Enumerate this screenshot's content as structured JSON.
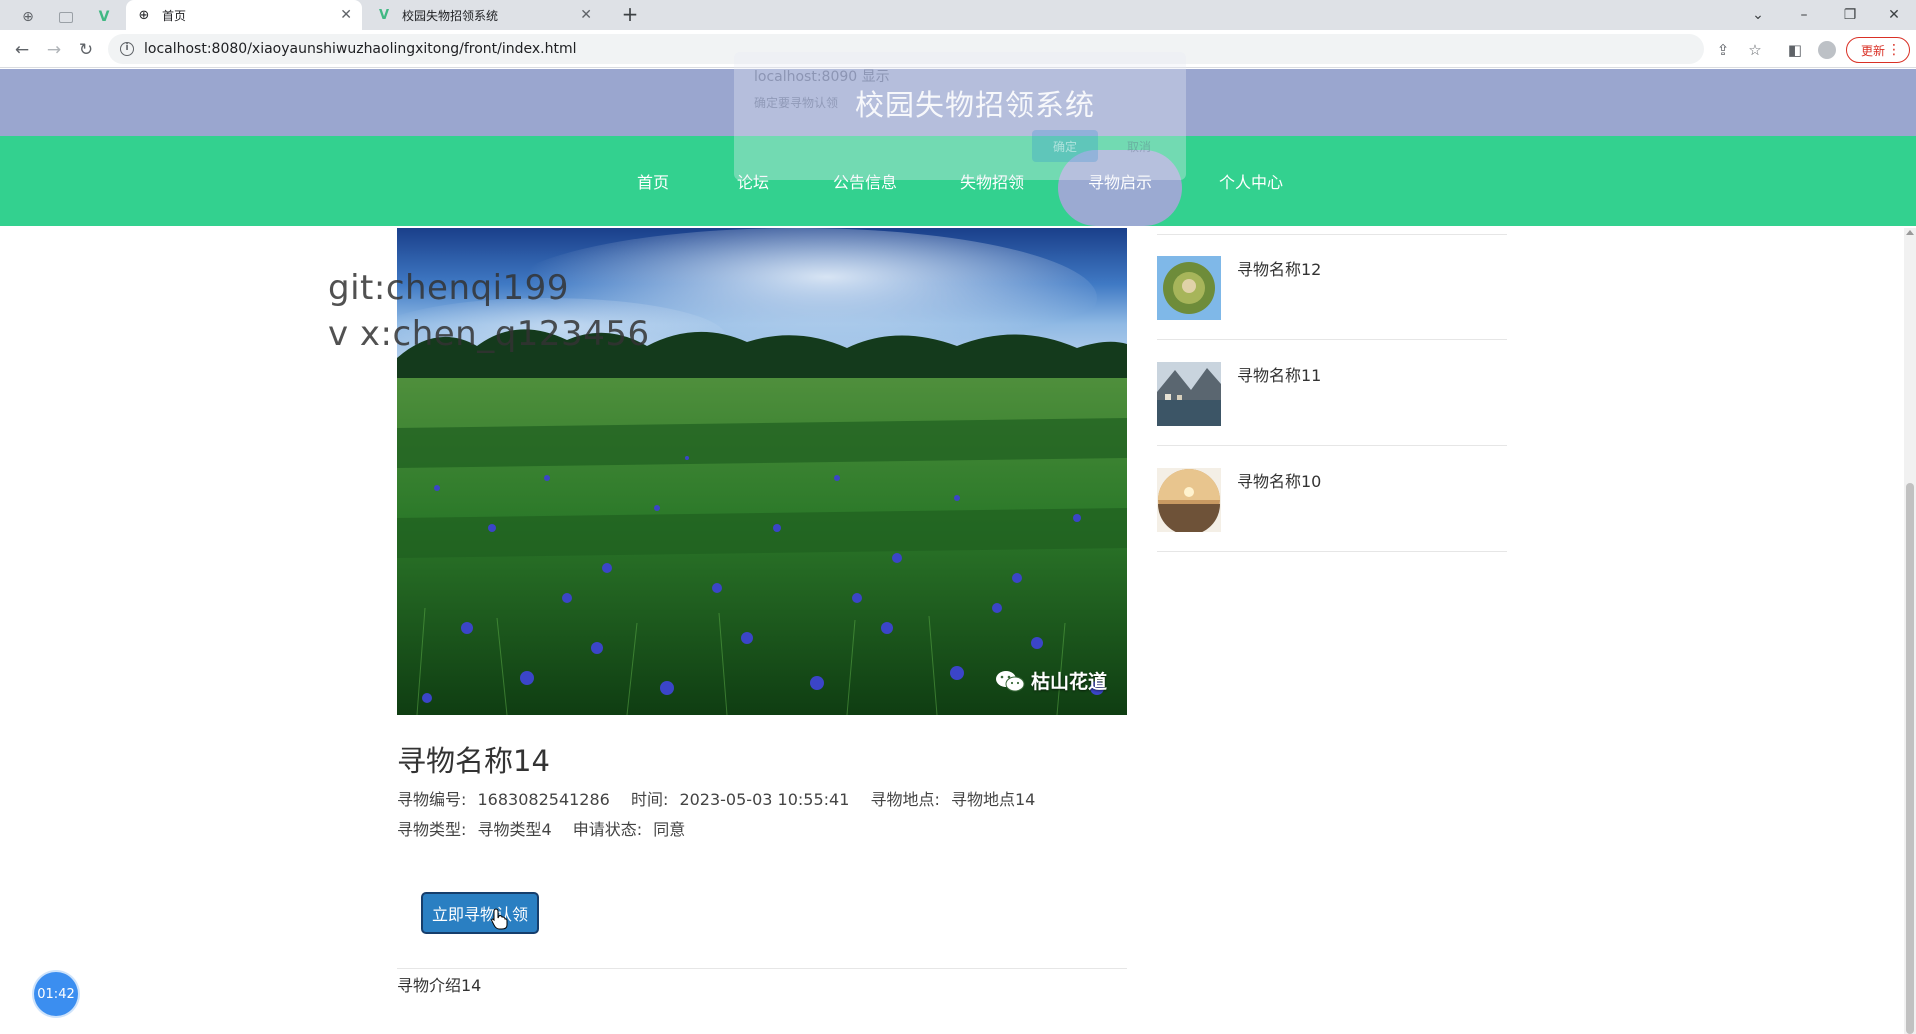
{
  "browser": {
    "tabs": [
      {
        "label": "首页",
        "active": true
      },
      {
        "label": "校园失物招领系统",
        "active": false
      }
    ],
    "url": "localhost:8080/xiaoyaunshiwuzhaolingxitong/front/index.html",
    "update_label": "更新"
  },
  "dialog": {
    "host": "localhost:8090 显示",
    "message": "确定要寻物认领",
    "ok_label": "确定",
    "cancel_label": "取消"
  },
  "header": {
    "title": "校园失物招领系统"
  },
  "nav": {
    "items": [
      "首页",
      "论坛",
      "公告信息",
      "失物招领",
      "寻物启示",
      "个人中心"
    ],
    "active_index": 4
  },
  "watermark": {
    "line1": "git:chenqi199",
    "line2": "v x:chen_q123456",
    "wechat": "枯山花道"
  },
  "detail": {
    "title": "寻物名称14",
    "meta": {
      "id_label": "寻物编号:",
      "id_value": "1683082541286",
      "time_label": "时间:",
      "time_value": "2023-05-03 10:55:41",
      "location_label": "寻物地点:",
      "location_value": "寻物地点14",
      "type_label": "寻物类型:",
      "type_value": "寻物类型4",
      "status_label": "申请状态:",
      "status_value": "同意"
    },
    "claim_button": "立即寻物认领",
    "intro": "寻物介绍14"
  },
  "sidebar": {
    "items": [
      {
        "name": "寻物名称12"
      },
      {
        "name": "寻物名称11"
      },
      {
        "name": "寻物名称10"
      }
    ]
  },
  "timer": {
    "value": "01:42"
  },
  "colors": {
    "header_bg": "#9aa6cf",
    "nav_bg": "#33d18f",
    "button_bg": "#2a7fc2"
  }
}
